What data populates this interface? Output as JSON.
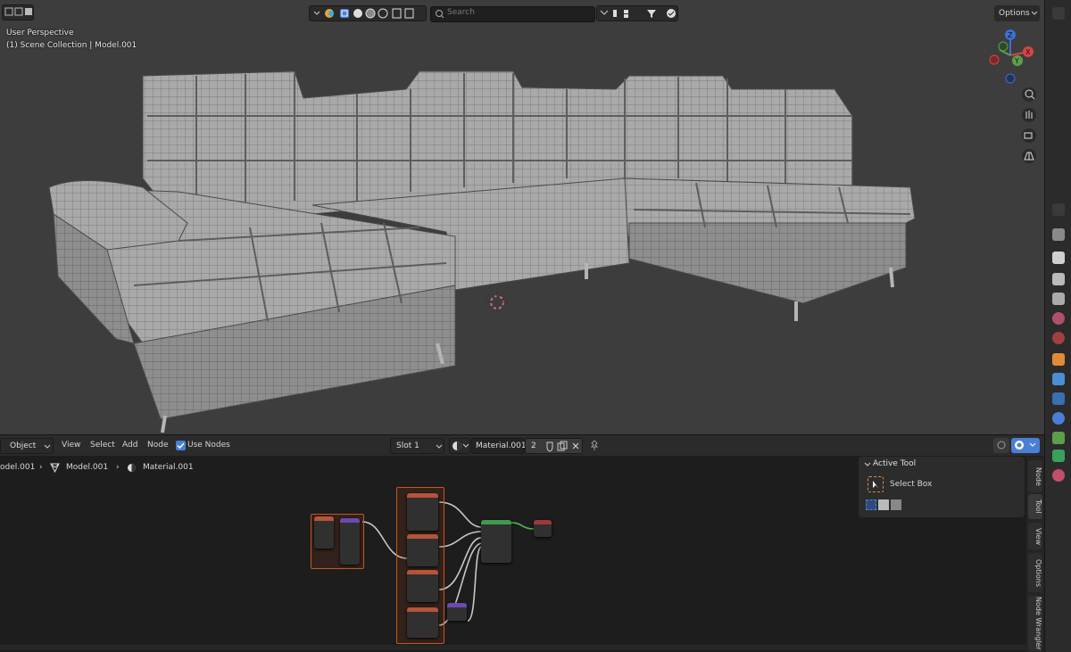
{
  "viewport": {
    "perspective_label": "User Perspective",
    "collection_label": "(1) Scene Collection | Model.001",
    "search_placeholder": "Search",
    "options_label": "Options"
  },
  "node_editor": {
    "object_mode": "Object",
    "menus": [
      "View",
      "Select",
      "Add",
      "Node"
    ],
    "use_nodes_label": "Use Nodes",
    "slot_label": "Slot 1",
    "material_name": "Material.001",
    "user_count": "2",
    "breadcrumb": {
      "object": "odel.001",
      "mesh": "Model.001",
      "material": "Material.001"
    }
  },
  "active_tool_panel": {
    "title": "Active Tool",
    "tool_name": "Select Box"
  },
  "side_tabs": [
    "Node",
    "Tool",
    "View",
    "Options",
    "Node Wrangler"
  ],
  "colors": {
    "viewport_bg": "#3d3d3d",
    "node_bg": "#1d1d1d",
    "frame": "#c8541c",
    "accent": "#4a7fd6"
  }
}
